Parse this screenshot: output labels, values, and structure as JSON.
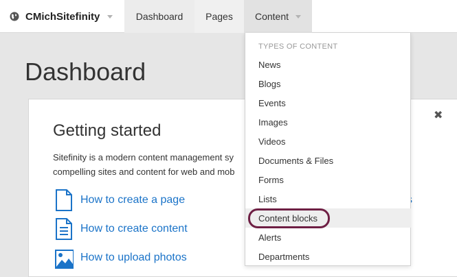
{
  "header": {
    "site_name": "CMichSitefinity",
    "tabs": [
      {
        "label": "Dashboard"
      },
      {
        "label": "Pages"
      },
      {
        "label": "Content"
      }
    ]
  },
  "main": {
    "page_title": "Dashboard",
    "getting_started": {
      "title": "Getting started",
      "description_line1": "Sitefinity is a modern content management sy",
      "description_line2": "compelling sites and content for web and mob",
      "links": [
        {
          "label": "How to create a page",
          "icon": "page-icon"
        },
        {
          "label": "How to create content",
          "icon": "document-icon"
        },
        {
          "label": "How to upload photos",
          "icon": "image-icon"
        }
      ],
      "right_fragment": "s"
    },
    "close_icon": "close-icon"
  },
  "content_menu": {
    "heading": "TYPES OF CONTENT",
    "items": [
      {
        "label": "News"
      },
      {
        "label": "Blogs"
      },
      {
        "label": "Events"
      },
      {
        "label": "Images"
      },
      {
        "label": "Videos"
      },
      {
        "label": "Documents & Files"
      },
      {
        "label": "Forms"
      },
      {
        "label": "Lists"
      },
      {
        "label": "Content blocks"
      },
      {
        "label": "Alerts"
      },
      {
        "label": "Departments"
      }
    ],
    "hovered_item": "Content blocks"
  },
  "colors": {
    "link": "#1a73c8",
    "highlight_ring": "#6e1f44"
  }
}
